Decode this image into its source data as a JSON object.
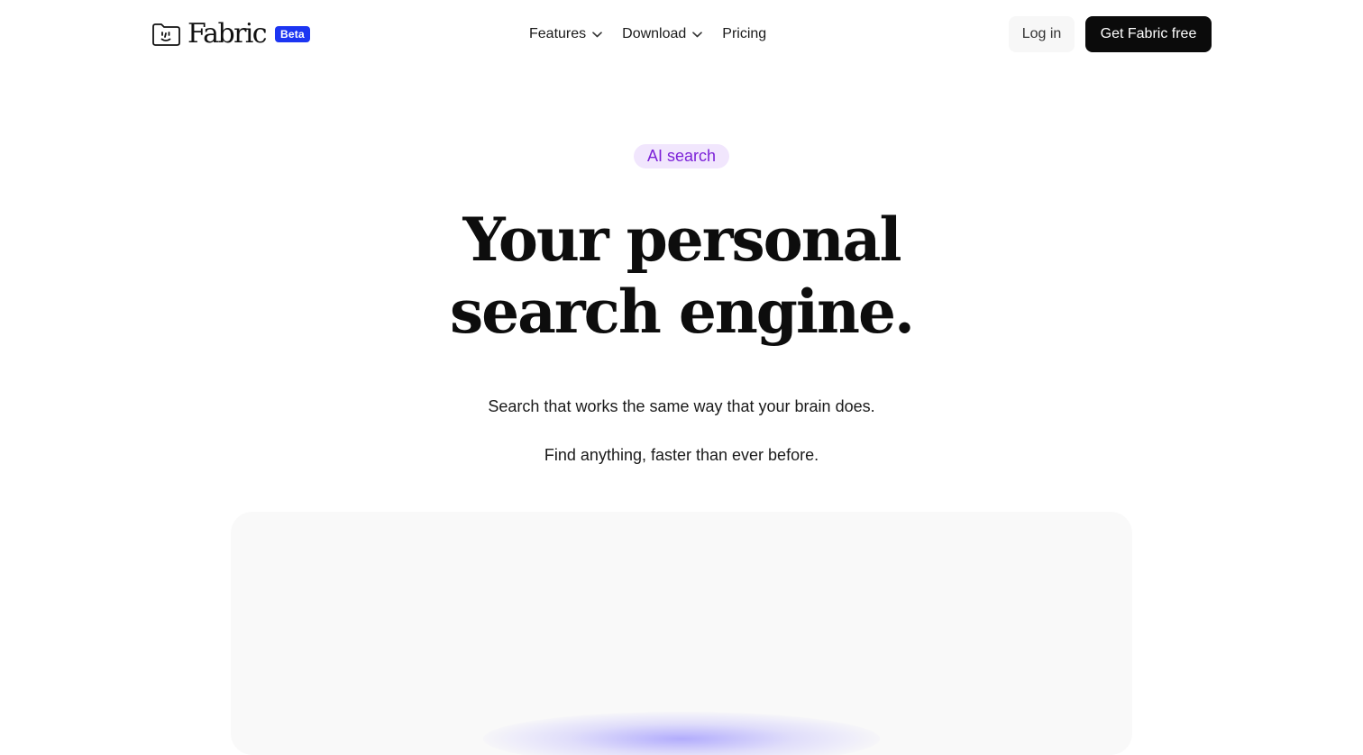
{
  "header": {
    "logo": {
      "icon": "folder-face-icon",
      "wordmark": "Fabric",
      "badge": "Beta",
      "badge_color": "#1c35f2"
    },
    "nav": [
      {
        "label": "Features",
        "has_dropdown": true
      },
      {
        "label": "Download",
        "has_dropdown": true
      },
      {
        "label": "Pricing",
        "has_dropdown": false
      }
    ],
    "login_label": "Log in",
    "cta_label": "Get Fabric free"
  },
  "hero": {
    "tag": "AI search",
    "tag_color": "#7c22d8",
    "headline_line1": "Your personal",
    "headline_line2": "search engine.",
    "subtext1": "Search that works the same way that your brain does.",
    "subtext2": "Find anything, faster than ever before."
  },
  "colors": {
    "cta_background": "#0b0b0b",
    "preview_background": "#f9f9f9",
    "glow": "#786eff"
  }
}
